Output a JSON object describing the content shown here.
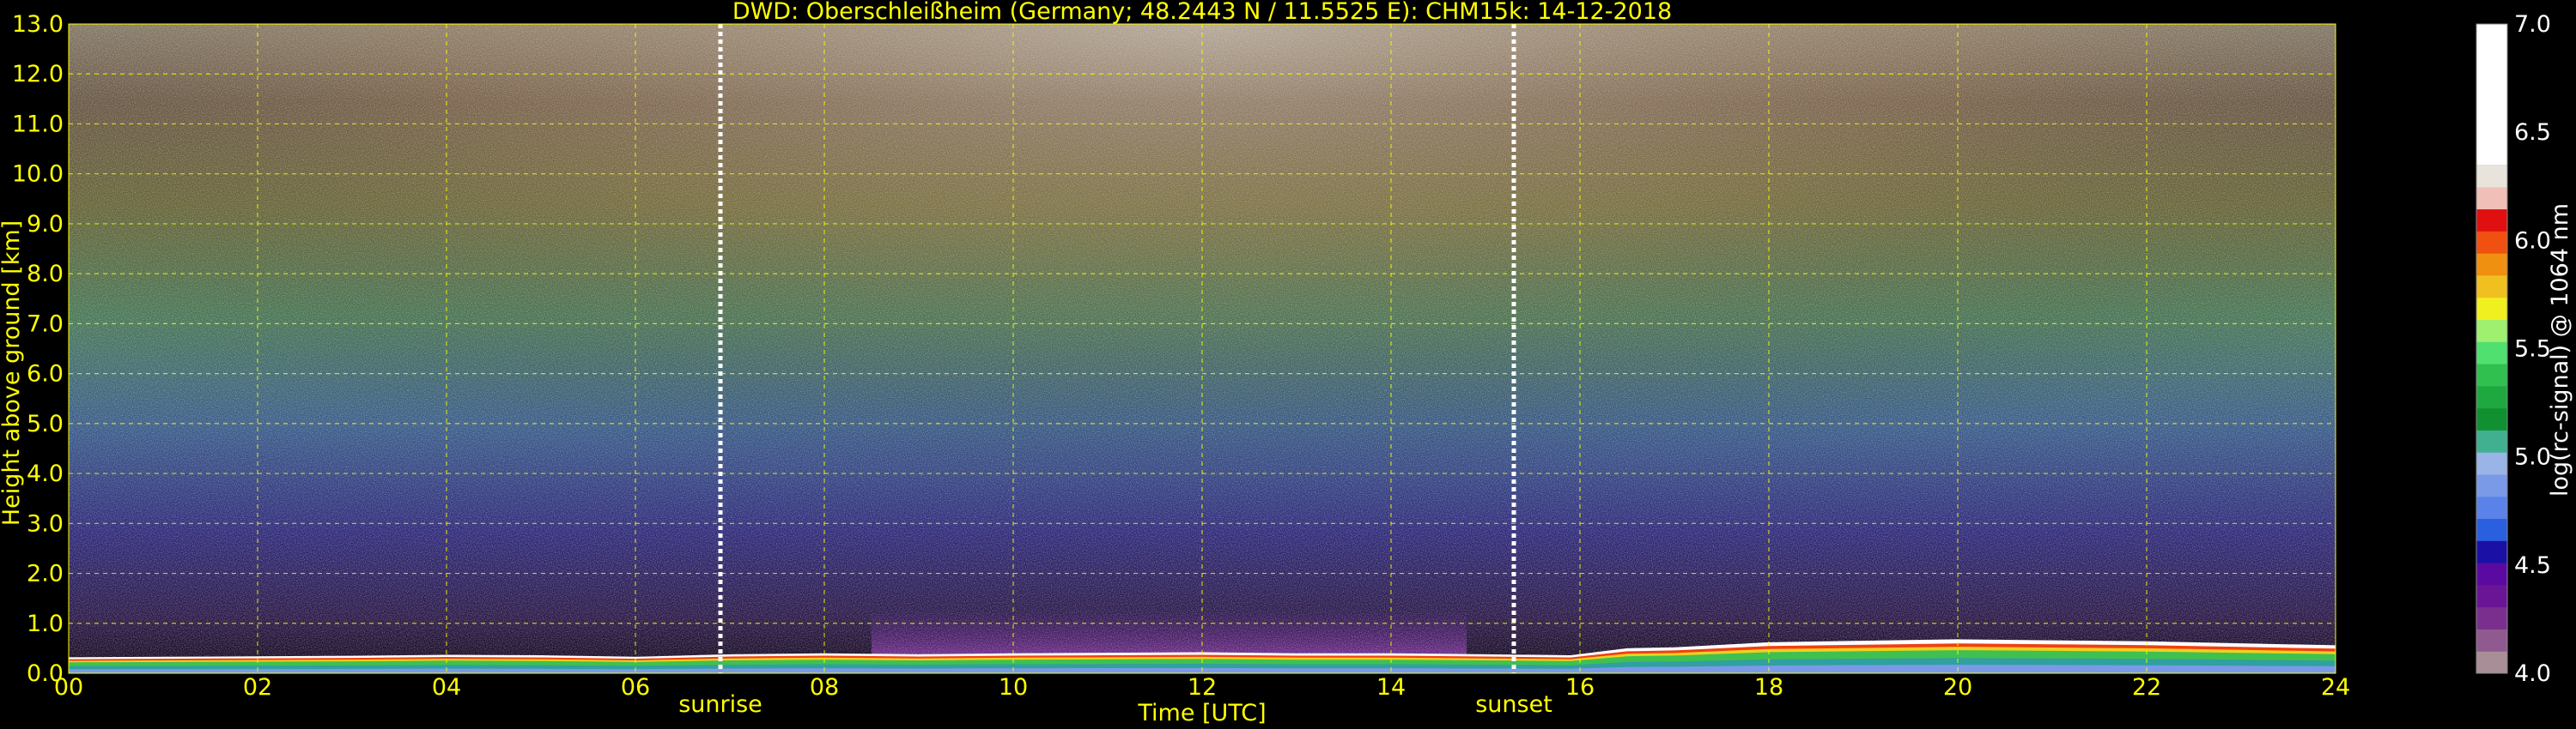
{
  "chart_data": {
    "type": "heatmap",
    "title": "DWD: Oberschleißheim (Germany; 48.2443 N / 11.5525 E):    CHM15k: 14-12-2018",
    "xlabel": "Time [UTC]",
    "ylabel": "Height above ground [km]",
    "colorbar_label": "log(rc-signal) @ 1064 nm",
    "x_range": [
      0,
      24
    ],
    "y_range": [
      0,
      13
    ],
    "x_ticks": [
      "00",
      "02",
      "04",
      "06",
      "08",
      "10",
      "12",
      "14",
      "16",
      "18",
      "20",
      "22",
      "24"
    ],
    "y_ticks": [
      "0.0",
      "1.0",
      "2.0",
      "3.0",
      "4.0",
      "5.0",
      "6.0",
      "7.0",
      "8.0",
      "9.0",
      "10.0",
      "11.0",
      "12.0",
      "13.0"
    ],
    "colorbar_range": [
      4.0,
      7.0
    ],
    "colorbar_ticks": [
      "4.0",
      "4.5",
      "5.0",
      "5.5",
      "6.0",
      "6.5",
      "7.0"
    ],
    "markers": [
      {
        "label": "sunrise",
        "time": 6.9
      },
      {
        "label": "sunset",
        "time": 15.3
      }
    ],
    "grid": true,
    "colorbar_colors": [
      "#a88f97",
      "#8f5a8f",
      "#7a2f8f",
      "#6a1496",
      "#5a0aa0",
      "#1a10a6",
      "#2a60e0",
      "#5a82e8",
      "#7a9ae8",
      "#9ab4e6",
      "#40b090",
      "#109030",
      "#20a840",
      "#30c050",
      "#50e070",
      "#a0f070",
      "#f0f020",
      "#f0c020",
      "#f09010",
      "#f05010",
      "#e01010",
      "#f0c0b8",
      "#e8e4dc",
      "#ffffff"
    ],
    "profile": {
      "hours": [
        0,
        1,
        2,
        3,
        4,
        5,
        6,
        7,
        8,
        9,
        10,
        11,
        12,
        13,
        14,
        15,
        15.9,
        16.5,
        17,
        18,
        19,
        20,
        21,
        22,
        23,
        24
      ],
      "boundary_layer_top_km": [
        0.32,
        0.33,
        0.34,
        0.35,
        0.37,
        0.36,
        0.33,
        0.38,
        0.4,
        0.38,
        0.4,
        0.41,
        0.42,
        0.4,
        0.4,
        0.38,
        0.36,
        0.5,
        0.52,
        0.62,
        0.65,
        0.68,
        0.66,
        0.64,
        0.6,
        0.56
      ]
    }
  }
}
